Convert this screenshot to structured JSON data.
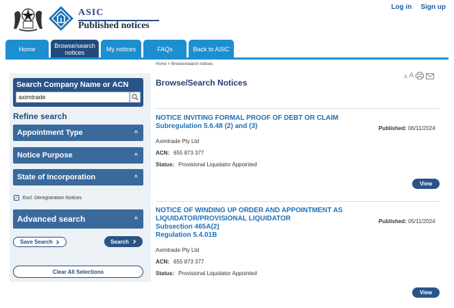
{
  "brand": {
    "name": "ASIC",
    "subtitle": "Published notices"
  },
  "top_links": {
    "login": "Log in",
    "signup": "Sign up"
  },
  "nav": [
    {
      "label": "Home"
    },
    {
      "label": "Browse/search notices"
    },
    {
      "label": "My notices"
    },
    {
      "label": "FAQs"
    },
    {
      "label": "Back to ASIC"
    }
  ],
  "sidebar": {
    "search_title": "Search Company Name or ACN",
    "search_value": "aximtrade",
    "refine_title": "Refine search",
    "accordions": [
      "Appointment Type",
      "Notice Purpose",
      "State of Incorporation"
    ],
    "excl_label": "Excl. Deregistration Notices",
    "excl_checked": true,
    "advanced": "Advanced search",
    "save_search": "Save Search",
    "search_btn": "Search",
    "clear_all": "Clear All Selections"
  },
  "breadcrumb": {
    "home": "Home",
    "sep": " > ",
    "current": "Browse/search notices"
  },
  "page_title": "Browse/Search Notices",
  "tools": {
    "small_a": "A",
    "big_a": "A"
  },
  "notices": [
    {
      "title_lines": [
        "NOTICE INVITING FORMAL PROOF OF DEBT OR CLAIM",
        "Subregulation 5.6.48 (2) and (3)"
      ],
      "published_label": "Published:",
      "published_date": "06/11/2024",
      "company": "Aximtrade Pty Ltd",
      "acn_label": "ACN:",
      "acn": "655 873 377",
      "status_label": "Status:",
      "status": "Provisional Liquidator Appointed",
      "view": "View"
    },
    {
      "title_lines": [
        "NOTICE OF WINDING UP ORDER AND APPOINTMENT AS",
        "LIQUIDATOR/PROVISIONAL LIQUIDATOR",
        "Subsection 465A(2)",
        "Regulation 5.4.01B"
      ],
      "published_label": "Published:",
      "published_date": "05/11/2024",
      "company": "Aximtrade Pty Ltd",
      "acn_label": "ACN:",
      "acn": "655 873 377",
      "status_label": "Status:",
      "status": "Provisional Liquidator Appointed",
      "view": "View"
    }
  ]
}
